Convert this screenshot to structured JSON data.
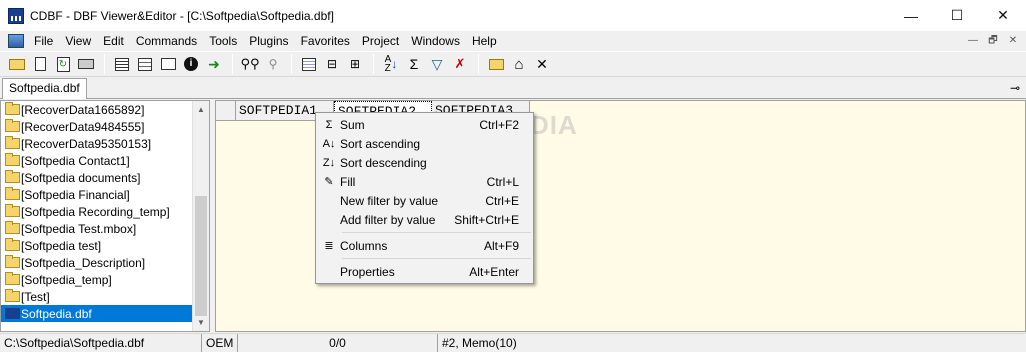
{
  "window": {
    "title": "CDBF - DBF Viewer&Editor - [C:\\Softpedia\\Softpedia.dbf]",
    "controls": [
      "—",
      "☐",
      "✕"
    ]
  },
  "menubar": {
    "items": [
      "File",
      "View",
      "Edit",
      "Commands",
      "Tools",
      "Plugins",
      "Favorites",
      "Project",
      "Windows",
      "Help"
    ],
    "mdi_controls": [
      "—",
      "🗗",
      "✕"
    ]
  },
  "toolbar": {
    "icons": [
      "open-folder-icon",
      "new-file-icon",
      "refresh-icon",
      "print-icon",
      "grid-view-icon",
      "form-view-icon",
      "record-icon",
      "info-icon",
      "goto-icon",
      "find-icon",
      "find-next-icon",
      "add-record-icon",
      "insert-column-icon",
      "delete-column-icon",
      "sort-icon",
      "sum-icon",
      "filter-icon",
      "clear-filter-icon",
      "mail-icon",
      "home-icon",
      "close-icon"
    ]
  },
  "tabs": {
    "active": "Softpedia.dbf"
  },
  "tree": {
    "items": [
      "[RecoverData1665892]",
      "[RecoverData9484555]",
      "[RecoverData95350153]",
      "[Softpedia Contact1]",
      "[Softpedia documents]",
      "[Softpedia Financial]",
      "[Softpedia Recording_temp]",
      "[Softpedia Test.mbox]",
      "[Softpedia test]",
      "[Softpedia_Description]",
      "[Softpedia_temp]",
      "[Test]"
    ],
    "selected": "Softpedia.dbf"
  },
  "grid": {
    "columns": [
      "SOFTPEDIA1",
      "SOFTPEDIA2",
      "SOFTPEDIA3"
    ]
  },
  "context_menu": {
    "items": [
      {
        "icon": "Σ",
        "label": "Sum",
        "shortcut": "Ctrl+F2"
      },
      {
        "icon": "A↓",
        "label": "Sort ascending",
        "shortcut": ""
      },
      {
        "icon": "Z↓",
        "label": "Sort descending",
        "shortcut": ""
      },
      {
        "icon": "✎",
        "label": "Fill",
        "shortcut": "Ctrl+L"
      },
      {
        "icon": "",
        "label": "New filter by value",
        "shortcut": "Ctrl+E"
      },
      {
        "icon": "",
        "label": "Add filter by value",
        "shortcut": "Shift+Ctrl+E"
      },
      {
        "icon": "≣",
        "label": "Columns",
        "shortcut": "Alt+F9"
      },
      {
        "icon": "",
        "label": "Properties",
        "shortcut": "Alt+Enter"
      }
    ]
  },
  "status": {
    "path": "C:\\Softpedia\\Softpedia.dbf",
    "encoding": "OEM",
    "position": "0/0",
    "field": "#2, Memo(10)"
  },
  "watermark": "SOFTPEDIA"
}
